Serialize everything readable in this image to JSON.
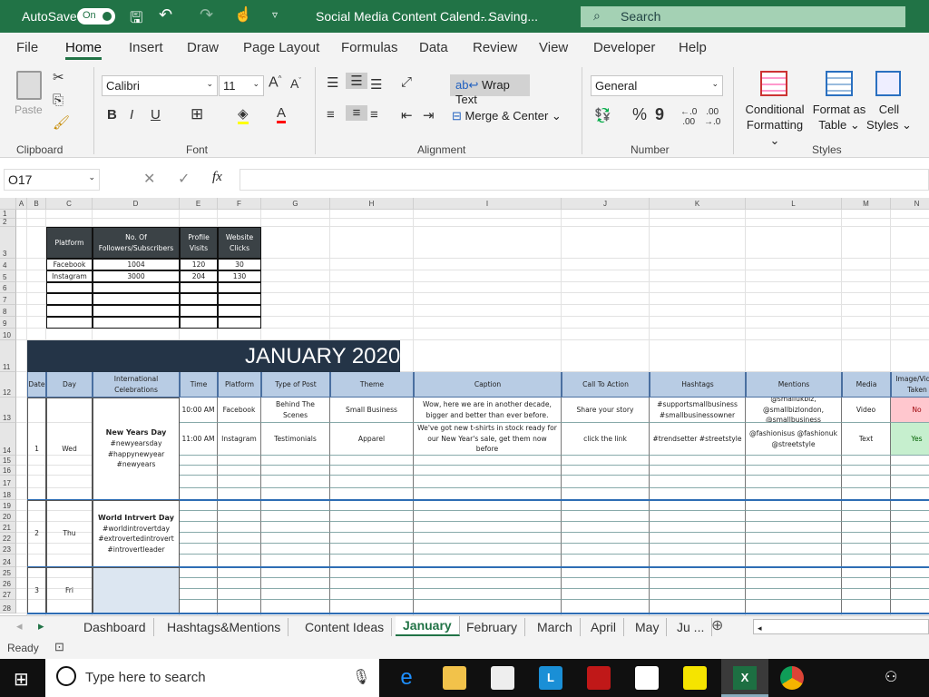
{
  "titlebar": {
    "autosave": "AutoSave",
    "toggle": "On",
    "doc_title": "Social Media Content Calend...",
    "status": "- Saving...",
    "search": "Search"
  },
  "menu": [
    "File",
    "Home",
    "Insert",
    "Draw",
    "Page Layout",
    "Formulas",
    "Data",
    "Review",
    "View",
    "Developer",
    "Help"
  ],
  "ribbon": {
    "paste": "Paste",
    "font_name": "Calibri",
    "font_size": "11",
    "wrap_text": "Wrap Text",
    "merge_center": "Merge & Center",
    "number_format": "General",
    "cond_format_1": "Conditional",
    "cond_format_2": "Formatting",
    "format_table_1": "Format as",
    "format_table_2": "Table",
    "cell_styles_1": "Cell",
    "cell_styles_2": "Styles",
    "groups": {
      "clipboard": "Clipboard",
      "font": "Font",
      "alignment": "Alignment",
      "number": "Number",
      "styles": "Styles"
    },
    "bold": "B",
    "italic": "I",
    "underline": "U",
    "percent": "%",
    "comma": "9"
  },
  "formula_bar": {
    "name_box": "O17",
    "fx": "fx",
    "value": ""
  },
  "columns": [
    "A",
    "B",
    "C",
    "D",
    "E",
    "F",
    "G",
    "H",
    "I",
    "J",
    "K",
    "L",
    "M",
    "N"
  ],
  "summary": {
    "headers": [
      "Platform",
      "No. Of Followers/Subscribers",
      "Profile Visits",
      "Website Clicks"
    ],
    "rows": [
      [
        "Facebook",
        "1004",
        "120",
        "30"
      ],
      [
        "Instagram",
        "3000",
        "204",
        "130"
      ]
    ]
  },
  "calendar": {
    "title": "JANUARY 2020",
    "headers": [
      "Date",
      "Day",
      "International Celebrations",
      "Time",
      "Platform",
      "Type of Post",
      "Theme",
      "Caption",
      "Call To Action",
      "Hashtags",
      "Mentions",
      "Media",
      "Image/Video Taken"
    ],
    "days": [
      {
        "date": "1",
        "day": "Wed",
        "celebration": "New Years Day",
        "tags": "#newyearsday\n#happynewyear\n#newyears"
      },
      {
        "date": "2",
        "day": "Thu",
        "celebration": "World Intrvert Day",
        "tags": "#worldintrovertday\n#extrovertedintrovert\n#introvertleader"
      },
      {
        "date": "3",
        "day": "Fri",
        "celebration": "",
        "tags": ""
      }
    ],
    "posts": [
      {
        "time": "10:00 AM",
        "platform": "Facebook",
        "type": "Behind The Scenes",
        "theme": "Small Business",
        "caption": "Wow, here we are in another decade, bigger and better than ever before.",
        "cta": "Share your story",
        "hashtags": "#supportsmallbusiness #smallbusinessowner",
        "mentions": "@smallukbiz, @smallbizlondon, @smallbusiness",
        "media": "Video",
        "taken": "No"
      },
      {
        "time": "11:00 AM",
        "platform": "Instagram",
        "type": "Testimonials",
        "theme": "Apparel",
        "caption": "We've got new t-shirts in stock ready for our New Year's sale, get them now before",
        "cta": "click the link",
        "hashtags": "#trendsetter #streetstyle",
        "mentions": "@fashionisus @fashionuk @streetstyle",
        "media": "Text",
        "taken": "Yes"
      }
    ]
  },
  "sheets": [
    "Dashboard",
    "Hashtags&Mentions",
    "Content Ideas",
    "January",
    "February",
    "March",
    "April",
    "May",
    "Ju ..."
  ],
  "active_sheet": "January",
  "status": {
    "ready": "Ready"
  },
  "taskbar": {
    "search": "Type here to search"
  },
  "colors": {
    "excel_green": "#217346",
    "title_navy": "#243447",
    "header_blue": "#b8cce4",
    "body_blue": "#dce6f1",
    "no_red": "#ffc7ce",
    "yes_green": "#c6efce"
  }
}
